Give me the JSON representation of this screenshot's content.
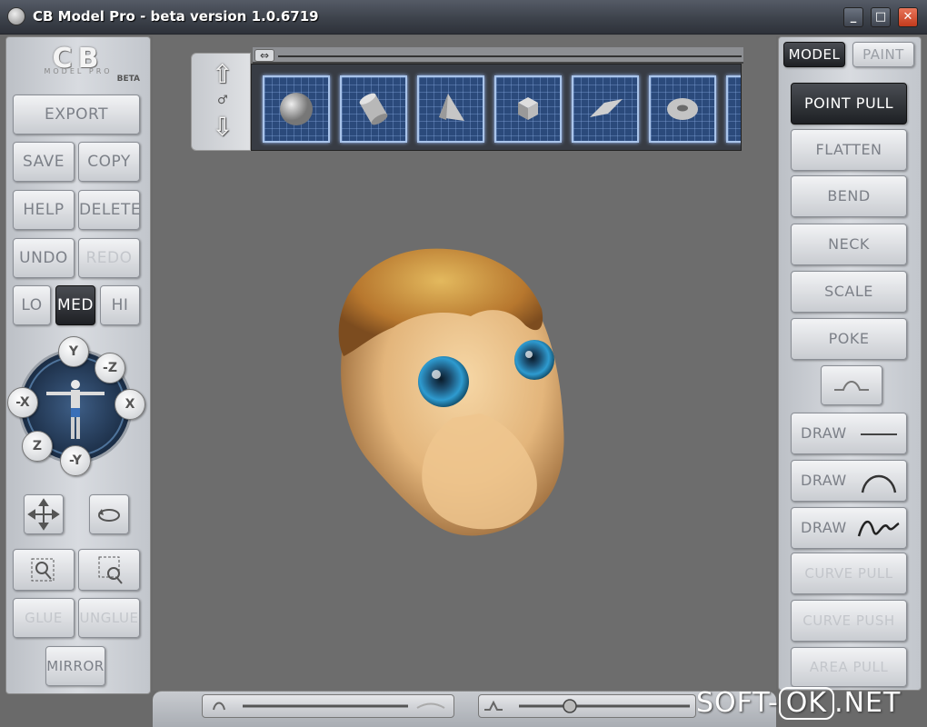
{
  "window": {
    "title": "CB Model Pro - beta version 1.0.6719",
    "minimize": "_",
    "maximize": "□",
    "close": "✕"
  },
  "logo": {
    "main": "CB",
    "sub": "MODEL PRO",
    "beta": "BETA"
  },
  "left": {
    "export": "EXPORT",
    "save": "SAVE",
    "copy": "COPY",
    "help": "HELP",
    "delete": "DELETE",
    "undo": "UNDO",
    "redo": "REDO",
    "lo": "LO",
    "med": "MED",
    "hi": "HI",
    "glue": "GLUE",
    "unglue": "UNGLUE",
    "mirror": "MIRROR",
    "axes": {
      "y": "Y",
      "neg_y": "-Y",
      "x": "X",
      "neg_x": "-X",
      "z": "Z",
      "neg_z": "-Z"
    }
  },
  "right": {
    "tab_model": "MODEL",
    "tab_paint": "PAINT",
    "point_pull": "POINT PULL",
    "flatten": "FLATTEN",
    "bend": "BEND",
    "neck": "NECK",
    "scale": "SCALE",
    "poke": "POKE",
    "draw1": "DRAW",
    "draw2": "DRAW",
    "draw3": "DRAW",
    "curve_pull": "CURVE PULL",
    "curve_push": "CURVE PUSH",
    "area_pull": "AREA PULL"
  },
  "shelf": {
    "scroll_icon": "⇔",
    "items": [
      "sphere-icon",
      "cylinder-icon",
      "cone-icon",
      "cube-icon",
      "plane-icon",
      "torus-icon"
    ]
  },
  "watermark": {
    "left": "SOFT-",
    "ok": "OK",
    "right": ".NET"
  },
  "colors": {
    "skin": "#e8c08a",
    "hair": "#c98a3a",
    "eye": "#2a84b8",
    "active_button": "#2b2d31"
  }
}
